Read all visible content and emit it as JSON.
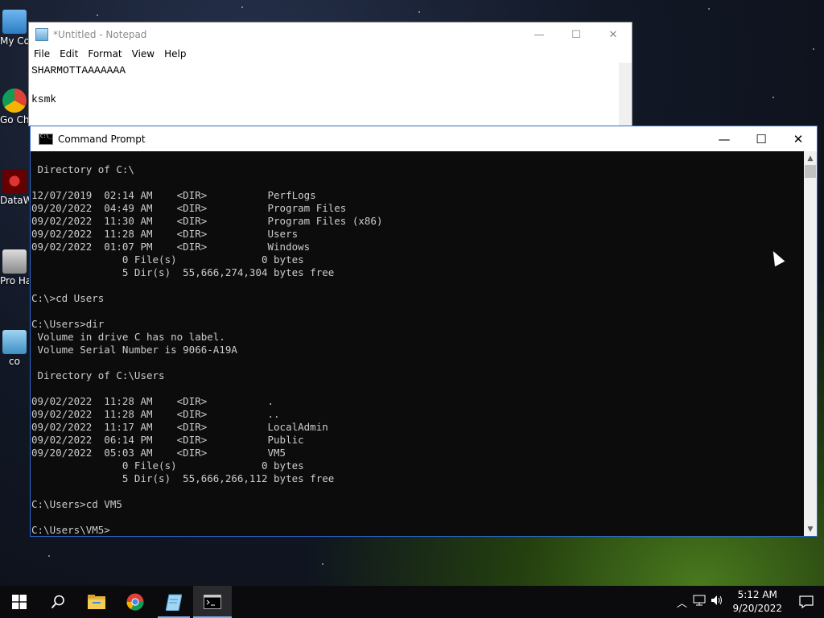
{
  "desktop": {
    "icons": [
      {
        "label": "My Co",
        "icon": "this-pc-icon"
      },
      {
        "label": "Go Ch",
        "icon": "chrome-icon"
      },
      {
        "label": "DataW",
        "icon": "datawrapper-icon"
      },
      {
        "label": "Pro Hac",
        "icon": "program-icon"
      },
      {
        "label": "co",
        "icon": "shortcut-icon"
      }
    ]
  },
  "notepad": {
    "title": "*Untitled - Notepad",
    "menu": [
      "File",
      "Edit",
      "Format",
      "View",
      "Help"
    ],
    "lines": [
      "SHARMOTTAAAAAAA",
      "",
      "ksmk"
    ],
    "minimize": "—",
    "maximize": "☐",
    "close": "✕"
  },
  "cmd": {
    "title": "Command Prompt",
    "minimize": "—",
    "maximize": "☐",
    "close": "✕",
    "lines": [
      " Directory of C:\\",
      "",
      "12/07/2019  02:14 AM    <DIR>          PerfLogs",
      "09/20/2022  04:49 AM    <DIR>          Program Files",
      "09/02/2022  11:30 AM    <DIR>          Program Files (x86)",
      "09/02/2022  11:28 AM    <DIR>          Users",
      "09/02/2022  01:07 PM    <DIR>          Windows",
      "               0 File(s)              0 bytes",
      "               5 Dir(s)  55,666,274,304 bytes free",
      "",
      "C:\\>cd Users",
      "",
      "C:\\Users>dir",
      " Volume in drive C has no label.",
      " Volume Serial Number is 9066-A19A",
      "",
      " Directory of C:\\Users",
      "",
      "09/02/2022  11:28 AM    <DIR>          .",
      "09/02/2022  11:28 AM    <DIR>          ..",
      "09/02/2022  11:17 AM    <DIR>          LocalAdmin",
      "09/02/2022  06:14 PM    <DIR>          Public",
      "09/20/2022  05:03 AM    <DIR>          VM5",
      "               0 File(s)              0 bytes",
      "               5 Dir(s)  55,666,266,112 bytes free",
      "",
      "C:\\Users>cd VM5",
      "",
      "C:\\Users\\VM5>"
    ]
  },
  "taskbar": {
    "start_icon": "windows-start-icon",
    "apps": [
      "search-icon",
      "file-explorer-icon",
      "chrome-icon",
      "notepad-icon",
      "cmd-icon"
    ],
    "clock": {
      "time": "5:12 AM",
      "date": "9/20/2022"
    },
    "tray": [
      "chevron-up-icon",
      "network-icon",
      "volume-icon"
    ]
  },
  "colors": {
    "cmd_text": "#cccccc",
    "cmd_bg": "#0c0c0c",
    "taskbar_bg": "#0b0b0d",
    "accent": "#7fb0e8"
  }
}
